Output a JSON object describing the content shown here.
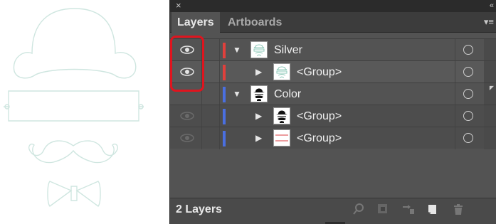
{
  "panel": {
    "close_glyph": "×",
    "collapse_glyph": "«",
    "menu_glyph": "▾≡",
    "tabs": [
      {
        "label": "Layers",
        "active": true
      },
      {
        "label": "Artboards",
        "active": false
      }
    ]
  },
  "layers": [
    {
      "name": "Silver",
      "expanded": true,
      "visible": true,
      "color": "#e0403c",
      "thumb": "silver-group"
    },
    {
      "name": "<Group>",
      "expanded": false,
      "visible": true,
      "color": "#e0403c",
      "thumb": "silver-group"
    },
    {
      "name": "Color",
      "expanded": true,
      "visible": false,
      "color": "#4a6fe0",
      "thumb": "black-hat"
    },
    {
      "name": "<Group>",
      "expanded": false,
      "visible": false,
      "color": "#4a6fe0",
      "thumb": "black-hat"
    },
    {
      "name": "<Group>",
      "expanded": false,
      "visible": false,
      "color": "#4a6fe0",
      "thumb": "banner-lines"
    }
  ],
  "footer": {
    "count_label": "2 Layers",
    "icons": [
      "locate-object-icon",
      "make-clipping-mask-icon",
      "create-sublayer-icon",
      "new-layer-icon",
      "delete-icon"
    ]
  },
  "colors": {
    "panel_bg": "#535353",
    "tab_bg": "#3c3c3c",
    "highlight": "#e0141e",
    "artwork_stroke": "#cfe6e0"
  }
}
